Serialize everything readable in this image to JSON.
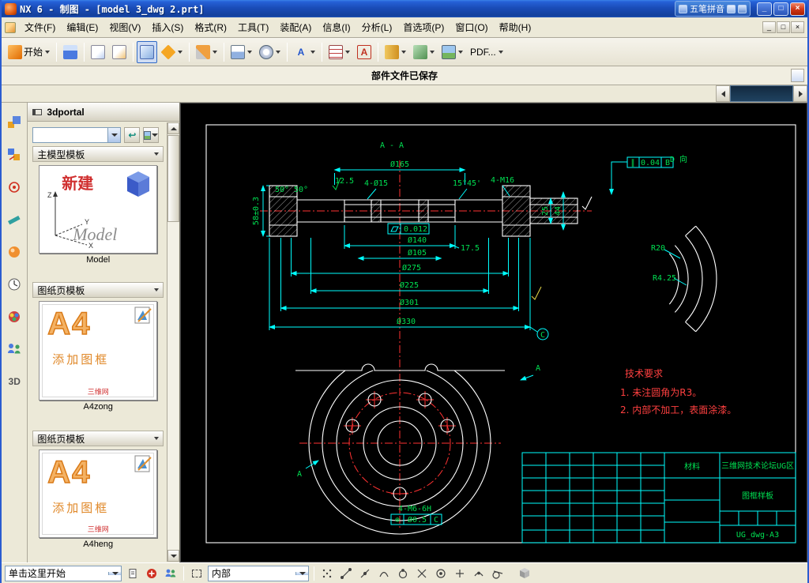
{
  "window": {
    "title": "NX 6 - 制图 - [model 3_dwg 2.prt]",
    "ime_label": "五笔拼音",
    "controls": {
      "minimize": "_",
      "restore": "□",
      "close": "×"
    }
  },
  "menubar": {
    "items": [
      "文件(F)",
      "编辑(E)",
      "视图(V)",
      "插入(S)",
      "格式(R)",
      "工具(T)",
      "装配(A)",
      "信息(I)",
      "分析(L)",
      "首选项(P)",
      "窗口(O)",
      "帮助(H)"
    ],
    "controls": {
      "minimize": "_",
      "restore": "□",
      "close": "×"
    }
  },
  "toolbar": {
    "start": "开始",
    "pdf": "PDF..."
  },
  "prompt": {
    "message": "部件文件已保存"
  },
  "icons": {
    "annotation_glyph": "A",
    "note_glyph": "A",
    "hd3d_glyph": "3D",
    "back_glyph": "↩"
  },
  "palette": {
    "title": "3dportal",
    "sections": [
      {
        "header": "主模型模板",
        "caption": "Model",
        "preview_title": "新建",
        "preview_word": "Model",
        "axis_z": "Z",
        "axis_x": "X",
        "axis_y": "Y"
      },
      {
        "header": "图纸页模板",
        "caption": "A4zong",
        "preview_big": "A4",
        "preview_text": "添加图框",
        "preview_brand": "三维网"
      },
      {
        "header": "图纸页模板",
        "caption": "A4heng",
        "preview_big": "A4",
        "preview_text": "添加图框",
        "preview_brand": "三维网"
      }
    ]
  },
  "drawing": {
    "section_label": "A - A",
    "view_d_label": "D 向",
    "cut_label": "A",
    "datum_c": "C",
    "thread_note": "4-M6-6H",
    "dims": {
      "d165": "Ø165",
      "holes": "4-Ø15",
      "ang1545": "15°45'",
      "m16": "4-M16",
      "rough": "12.5",
      "ang50": "50°",
      "h58": "58±0.3",
      "w25": "25",
      "w44": "44",
      "d140": "Ø140",
      "d105": "Ø105",
      "v175": "17.5",
      "d275": "Ø275",
      "d225": "Ø225",
      "d301": "Ø301",
      "d330": "Ø330",
      "r20": "R20",
      "r425": "R4.25"
    },
    "fcf_parallel": {
      "sym": "∥",
      "val": "0.04",
      "ref": "B"
    },
    "fcf_flat": {
      "val": "0.012"
    },
    "fcf_pos": {
      "sym": "⊕",
      "val": "Ø0.5",
      "ref": "C"
    },
    "tech_notes": [
      "技术要求",
      "1. 未注圆角为R3。",
      "2. 内部不加工，表面涂漆。"
    ],
    "titleblock": {
      "material": "材料",
      "org": "三维网技术论坛UG区",
      "sheet_name": "图框样板",
      "sheet_code": "UG_dwg-A3"
    }
  },
  "bottombar": {
    "cue": "单击这里开始",
    "scope": "内部"
  },
  "colors": {
    "titlebar_blue": "#1c55c8",
    "toolbar_gray": "#ece9d8",
    "canvas_black": "#000000",
    "geometry_white": "#ffffff",
    "dimension_green": "#00e052",
    "line_cyan": "#00ffff",
    "centerline_red": "#ff3232",
    "ime_blue": "#2a5cb8"
  }
}
